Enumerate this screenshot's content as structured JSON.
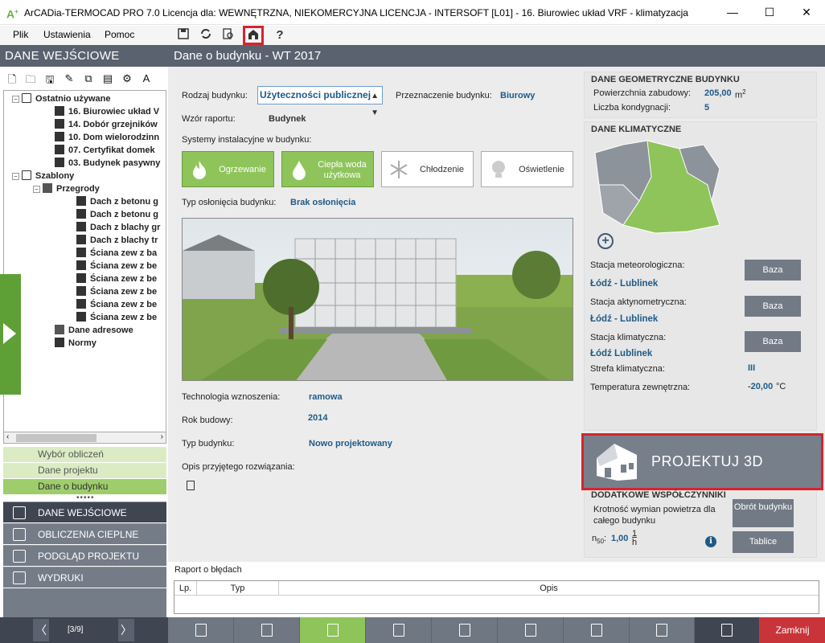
{
  "window": {
    "title": "ArCADia-TERMOCAD PRO 7.0 Licencja dla: WEWNĘTRZNA, NIEKOMERCYJNA LICENCJA - INTERSOFT [L01] - 16. Biurowiec układ VRF - klimatyzacja",
    "minimize": "—",
    "maximize": "☐",
    "close": "✕"
  },
  "menu": {
    "plik": "Plik",
    "ustawienia": "Ustawienia",
    "pomoc": "Pomoc"
  },
  "toolbar": {
    "help": "?"
  },
  "left_panel": {
    "header": "DANE WEJŚCIOWE",
    "tree": {
      "recent": "Ostatnio używane",
      "recent_items": [
        "16. Biurowiec układ V",
        "14. Dobór grzejników",
        "10. Dom wielorodzinn",
        "07. Certyfikat domek",
        "03. Budynek pasywny"
      ],
      "templates": "Szablony",
      "partitions": "Przegrody",
      "partition_items": [
        "Dach z betonu g",
        "Dach z betonu g",
        "Dach z blachy gr",
        "Dach z blachy tr",
        "Ściana zew z ba",
        "Ściana zew z be",
        "Ściana zew z be",
        "Ściana zew z be",
        "Ściana zew z be",
        "Ściana zew z be"
      ],
      "addresses": "Dane adresowe",
      "norms": "Normy"
    },
    "subnav": [
      "Wybór obliczeń",
      "Dane projektu",
      "Dane o budynku"
    ],
    "mainnav": [
      "DANE WEJŚCIOWE",
      "OBLICZENIA CIEPLNE",
      "PODGLĄD PROJEKTU",
      "WYDRUKI"
    ],
    "pager": {
      "label": "[3/9]",
      "prev": "〈",
      "next": "〉"
    }
  },
  "main": {
    "header": "Dane o budynku - WT 2017",
    "rodzaj_label": "Rodzaj budynku:",
    "rodzaj_value": "Użyteczności publicznej",
    "przeznaczenie_label": "Przeznaczenie budynku:",
    "przeznaczenie_value": "Biurowy",
    "wzor_label": "Wzór raportu:",
    "wzor_value": "Budynek",
    "systemy_label": "Systemy instalacyjne w budynku:",
    "systems": [
      {
        "label": "Ogrzewanie",
        "active": true
      },
      {
        "label": "Ciepła woda użytkowa",
        "active": true
      },
      {
        "label": "Chłodzenie",
        "active": false
      },
      {
        "label": "Oświetlenie",
        "active": false
      }
    ],
    "oslona_label": "Typ osłonięcia budynku:",
    "oslona_value": "Brak osłonięcia",
    "technologia_label": "Technologia wznoszenia:",
    "technologia_value": "ramowa",
    "rok_label": "Rok budowy:",
    "rok_value": "2014",
    "typ_label": "Typ budynku:",
    "typ_value": "Nowo projektowany",
    "opis_label": "Opis przyjętego rozwiązania:"
  },
  "geometry": {
    "title": "DANE GEOMETRYCZNE BUDYNKU",
    "area_label": "Powierzchnia zabudowy:",
    "area_value": "205,00",
    "area_unit": "m",
    "area_sup": "2",
    "floors_label": "Liczba kondygnacji:",
    "floors_value": "5"
  },
  "climate": {
    "title": "DANE KLIMATYCZNE",
    "meteo_label": "Stacja meteorologiczna:",
    "meteo_value": "Łódź - Lublinek",
    "akty_label": "Stacja aktynometryczna:",
    "akty_value": "Łódź - Lublinek",
    "klim_label": "Stacja klimatyczna:",
    "klim_value": "Łódź Lublinek",
    "strefa_label": "Strefa klimatyczna:",
    "strefa_value": "III",
    "temp_label": "Temperatura zewnętrzna:",
    "temp_value": "-20,00",
    "temp_unit": "°C",
    "baza": "Baza",
    "plus": "+"
  },
  "projektuj": "PROJEKTUJ 3D",
  "extra": {
    "title": "DODATKOWE WSPÓŁCZYNNIKI",
    "krotnosc_label": "Krotność wymian powietrza dla całego budynku",
    "n50_label": "n",
    "n50_sub": "50",
    "n50_value": "1,00",
    "n50_unit_top": "1",
    "n50_unit_bot": "h",
    "obrot_btn": "Obrót budynku",
    "tablice_btn": "Tablice",
    "info": "i"
  },
  "raport": {
    "title": "Raport o błędach",
    "cols": [
      "Lp.",
      "Typ",
      "Opis"
    ]
  },
  "bottom": {
    "zamknij": "Zamknij"
  },
  "colors": {
    "accent_green": "#8fc45b",
    "header_gray": "#5a6270",
    "value_blue": "#1f5a86",
    "highlight_red": "#d9232d"
  }
}
